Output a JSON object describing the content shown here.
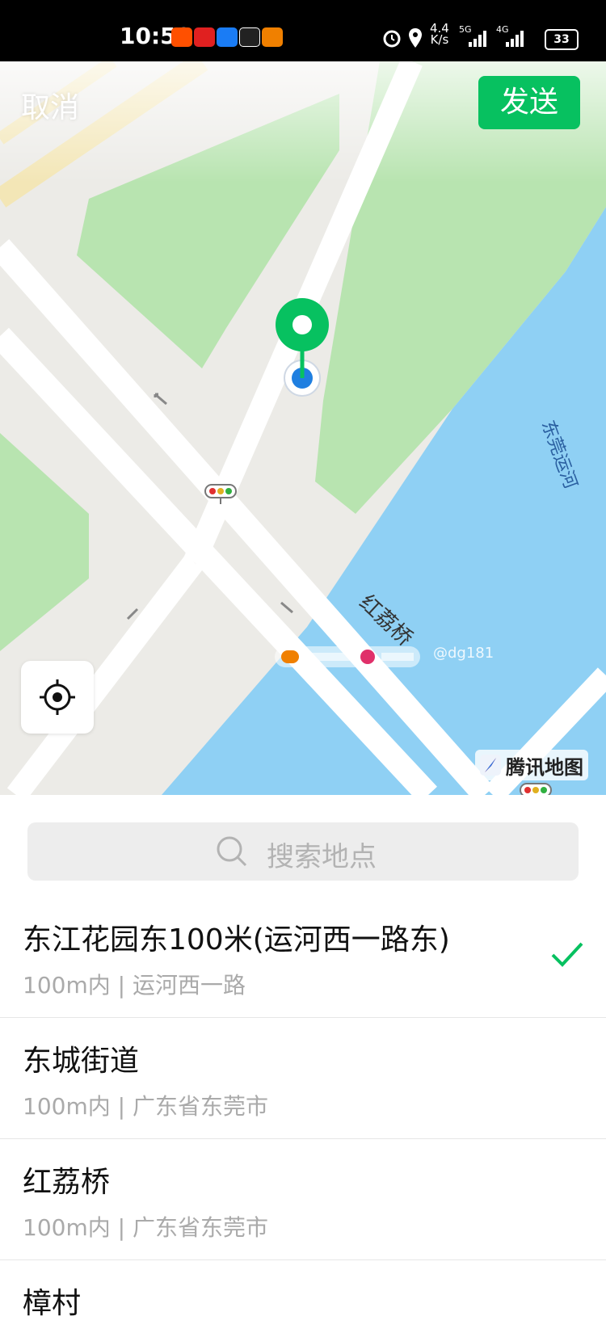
{
  "status_bar": {
    "time": "10:50",
    "net_speed_value": "4.4",
    "net_speed_unit": "K/s",
    "sim1": "5G",
    "sim2": "4G",
    "battery": "33"
  },
  "header": {
    "cancel_label": "取消",
    "send_label": "发送"
  },
  "map": {
    "street_label": "红荔桥",
    "river_label": "东莞运河",
    "brand_label": "腾讯地图",
    "watermark_handle": "@dg181",
    "colors": {
      "road": "#ffffff",
      "land": "#ecebe7",
      "park": "#b8e4b0",
      "water": "#8fd0f4",
      "pin": "#07c160",
      "location": "#1f7fe0"
    }
  },
  "search": {
    "placeholder": "搜索地点"
  },
  "results": [
    {
      "title": "东江花园东100米(运河西一路东)",
      "subtitle": "100m内 | 运河西一路",
      "selected": true
    },
    {
      "title": "东城街道",
      "subtitle": "100m内 | 广东省东莞市",
      "selected": false
    },
    {
      "title": "红荔桥",
      "subtitle": "100m内 | 广东省东莞市",
      "selected": false
    },
    {
      "title": "樟村",
      "subtitle": "",
      "selected": false
    }
  ]
}
